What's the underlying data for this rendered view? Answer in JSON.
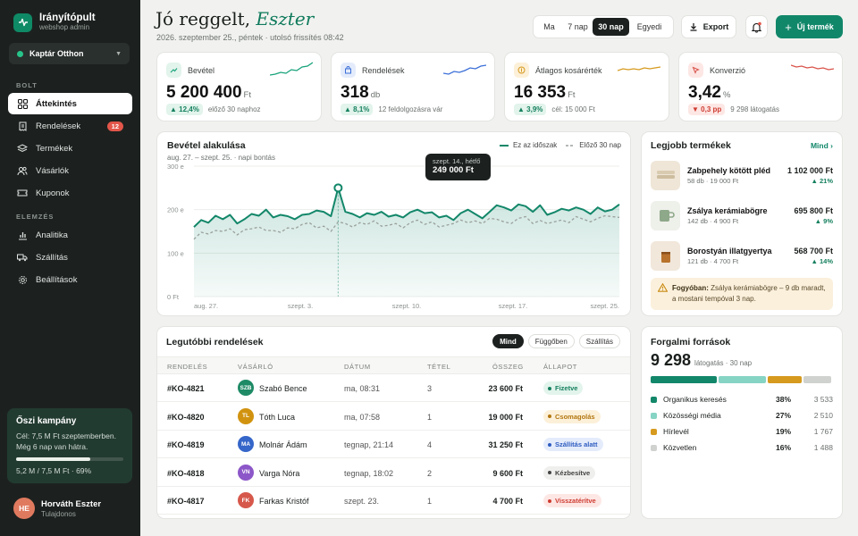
{
  "app": {
    "title": "Irányítópult",
    "subtitle": "webshop admin"
  },
  "store": {
    "name": "Kaptár Otthon"
  },
  "sidebar": {
    "section1": "BOLT",
    "section2": "ELEMZÉS",
    "items": [
      {
        "label": "Áttekintés",
        "icon": "grid-icon",
        "active": true
      },
      {
        "label": "Rendelések",
        "icon": "receipt-icon",
        "badge": "12"
      },
      {
        "label": "Termékek",
        "icon": "layers-icon"
      },
      {
        "label": "Vásárlók",
        "icon": "users-icon"
      },
      {
        "label": "Kuponok",
        "icon": "ticket-icon"
      },
      {
        "label": "Analitika",
        "icon": "bar-chart-icon"
      },
      {
        "label": "Szállítás",
        "icon": "truck-icon"
      },
      {
        "label": "Beállítások",
        "icon": "gear-icon"
      }
    ]
  },
  "campaign": {
    "title": "Őszi kampány",
    "desc": "Cél: 7,5 M Ft szeptemberben. Még 6 nap van hátra.",
    "progress_label": "5,2 M / 7,5 M Ft · 69%",
    "progress": 0.69
  },
  "user": {
    "name": "Horváth Eszter",
    "role": "Tulajdonos",
    "initials": "HE"
  },
  "header": {
    "greeting": "Jó reggelt,",
    "name": "Eszter",
    "subtitle": "2026. szeptember 25., péntek · utolsó frissítés 08:42",
    "ranges": [
      "Ma",
      "7 nap",
      "30 nap",
      "Egyedi"
    ],
    "active_range": "30 nap",
    "export_label": "Export",
    "new_label": "Új termék"
  },
  "kpis": [
    {
      "label": "Bevétel",
      "value": "5 200 400",
      "unit": "Ft",
      "delta": "12,4%",
      "dir": "up",
      "note": "előző 30 naphoz",
      "color": "#16a27a"
    },
    {
      "label": "Rendelések",
      "value": "318",
      "unit": "db",
      "delta": "8,1%",
      "dir": "up",
      "note": "12 feldolgozásra vár",
      "color": "#3b6fd8"
    },
    {
      "label": "Átlagos kosárérték",
      "value": "16 353",
      "unit": "Ft",
      "delta": "3,9%",
      "dir": "up",
      "note": "cél: 15 000 Ft",
      "color": "#d69a1e"
    },
    {
      "label": "Konverzió",
      "value": "3,42",
      "unit": "%",
      "delta": "0,3 pp",
      "dir": "down",
      "note": "9 298 látogatás",
      "color": "#d9534a"
    }
  ],
  "revenue_chart": {
    "title": "Bevétel alakulása",
    "subtitle": "aug. 27. – szept. 25. · napi bontás",
    "legend_current": "Ez az időszak",
    "legend_prev": "Előző 30 nap",
    "tooltip_date": "szept. 14., hétfő",
    "tooltip_value": "249 000 Ft"
  },
  "chart_data": {
    "type": "area",
    "title": "Bevétel alakulása",
    "x_ticks": [
      "aug. 27.",
      "szept. 3.",
      "szept. 10.",
      "szept. 17.",
      "szept. 25."
    ],
    "y_ticks": [
      "0 Ft",
      "100 e",
      "200 e",
      "300 e"
    ],
    "ylim": [
      0,
      300
    ],
    "series": [
      {
        "name": "Ez az időszak",
        "color": "#13876a",
        "values": [
          160,
          176,
          170,
          186,
          178,
          188,
          168,
          178,
          190,
          186,
          200,
          182,
          188,
          185,
          178,
          188,
          190,
          198,
          195,
          185,
          250,
          195,
          190,
          182,
          192,
          188,
          195,
          184,
          188,
          182,
          194,
          200,
          192,
          194,
          182,
          186,
          176,
          192,
          200,
          190,
          180,
          195,
          210,
          205,
          198,
          212,
          208,
          195,
          210,
          188,
          194,
          202,
          198,
          205,
          200,
          190,
          205,
          196,
          200,
          212
        ]
      },
      {
        "name": "Előző 30 nap",
        "color": "#9aa09c",
        "values": [
          132,
          148,
          144,
          152,
          150,
          156,
          142,
          154,
          156,
          160,
          152,
          152,
          148,
          158,
          156,
          166,
          170,
          158,
          162,
          150,
          172,
          168,
          160,
          170,
          166,
          174,
          162,
          164,
          168,
          158,
          170,
          176,
          166,
          172,
          160,
          164,
          168,
          176,
          170,
          174,
          168,
          180,
          178,
          172,
          168,
          180,
          184,
          168,
          175,
          168,
          172,
          176,
          170,
          184,
          178,
          172,
          180,
          186,
          184,
          182
        ]
      }
    ]
  },
  "top_products": {
    "title": "Legjobb termékek",
    "more_label": "Mind ›",
    "items": [
      {
        "name": "Zabpehely kötött pléd",
        "sub": "58 db · 19 000 Ft",
        "value": "1 102 000 Ft",
        "delta": "▲ 21%",
        "icon": "blanket-icon"
      },
      {
        "name": "Zsálya kerámiabögre",
        "sub": "142 db · 4 900 Ft",
        "value": "695 800 Ft",
        "delta": "▲ 9%",
        "icon": "mug-icon"
      },
      {
        "name": "Borostyán illatgyertya",
        "sub": "121 db · 4 700 Ft",
        "value": "568 700 Ft",
        "delta": "▲ 14%",
        "icon": "candle-icon"
      }
    ],
    "alert_title": "Fogyóban:",
    "alert_text": "Zsálya kerámiabögre – 9 db maradt, a mostani tempóval 3 nap."
  },
  "orders": {
    "title": "Legutóbbi rendelések",
    "filters": [
      "Mind",
      "Függőben",
      "Szállítás"
    ],
    "columns": [
      "RENDELÉS",
      "VÁSÁRLÓ",
      "DÁTUM",
      "TÉTEL",
      "ÖSSZEG",
      "ÁLLAPOT"
    ],
    "rows": [
      {
        "id": "#KO-4821",
        "initials": "SZB",
        "customer": "Szabó Bence",
        "date": "ma, 08:31",
        "qty": "3",
        "amount": "23 600 Ft",
        "status": "Fizetve",
        "avatar": "#1e8a66",
        "st_bg": "#e2f4ec",
        "st_fg": "#16805f"
      },
      {
        "id": "#KO-4820",
        "initials": "TL",
        "customer": "Tóth Luca",
        "date": "ma, 07:58",
        "qty": "1",
        "amount": "19 000 Ft",
        "status": "Csomagolás",
        "avatar": "#d1930f",
        "st_bg": "#fcf0d9",
        "st_fg": "#b37710"
      },
      {
        "id": "#KO-4819",
        "initials": "MA",
        "customer": "Molnár Ádám",
        "date": "tegnap, 21:14",
        "qty": "4",
        "amount": "31 250 Ft",
        "status": "Szállítás alatt",
        "avatar": "#3566c9",
        "st_bg": "#e4ecfb",
        "st_fg": "#2e5cc0"
      },
      {
        "id": "#KO-4818",
        "initials": "VN",
        "customer": "Varga Nóra",
        "date": "tegnap, 18:02",
        "qty": "2",
        "amount": "9 600 Ft",
        "status": "Kézbesítve",
        "avatar": "#8c57c8",
        "st_bg": "#efefed",
        "st_fg": "#444"
      },
      {
        "id": "#KO-4817",
        "initials": "FK",
        "customer": "Farkas Kristóf",
        "date": "szept. 23.",
        "qty": "1",
        "amount": "4 700 Ft",
        "status": "Visszatérítve",
        "avatar": "#d6584b",
        "st_bg": "#fde7e5",
        "st_fg": "#cf3c31"
      }
    ]
  },
  "sources": {
    "title": "Forgalmi források",
    "total": "9 298",
    "total_unit": "látogatás · 30 nap",
    "items": [
      {
        "label": "Organikus keresés",
        "pct": "38%",
        "count": "3 533",
        "share": 38,
        "color": "#13876a"
      },
      {
        "label": "Közösségi média",
        "pct": "27%",
        "count": "2 510",
        "share": 27,
        "color": "#86d4c4"
      },
      {
        "label": "Hírlevél",
        "pct": "19%",
        "count": "1 767",
        "share": 19,
        "color": "#d69a1e"
      },
      {
        "label": "Közvetlen",
        "pct": "16%",
        "count": "1 488",
        "share": 16,
        "color": "#cfd2cf"
      }
    ]
  }
}
